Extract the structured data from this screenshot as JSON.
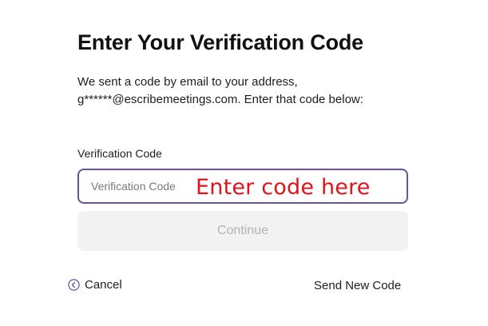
{
  "page": {
    "title": "Enter Your Verification Code",
    "description_line1": "We sent a code by email to your address,",
    "description_line2": "g******@escribemeetings.com. Enter that code below:"
  },
  "form": {
    "code_label": "Verification Code",
    "code_placeholder": "Verification Code",
    "code_value": "",
    "continue_label": "Continue",
    "continue_disabled": true
  },
  "annotation": {
    "text": "Enter code here",
    "color": "#e0131b"
  },
  "footer": {
    "cancel_label": "Cancel",
    "cancel_icon": "circle-arrow-left-icon",
    "send_new_code_label": "Send New Code"
  },
  "colors": {
    "input_border": "#6a4fa5",
    "button_disabled_bg": "#f2f2f3",
    "button_disabled_text": "#b3b3b6"
  }
}
